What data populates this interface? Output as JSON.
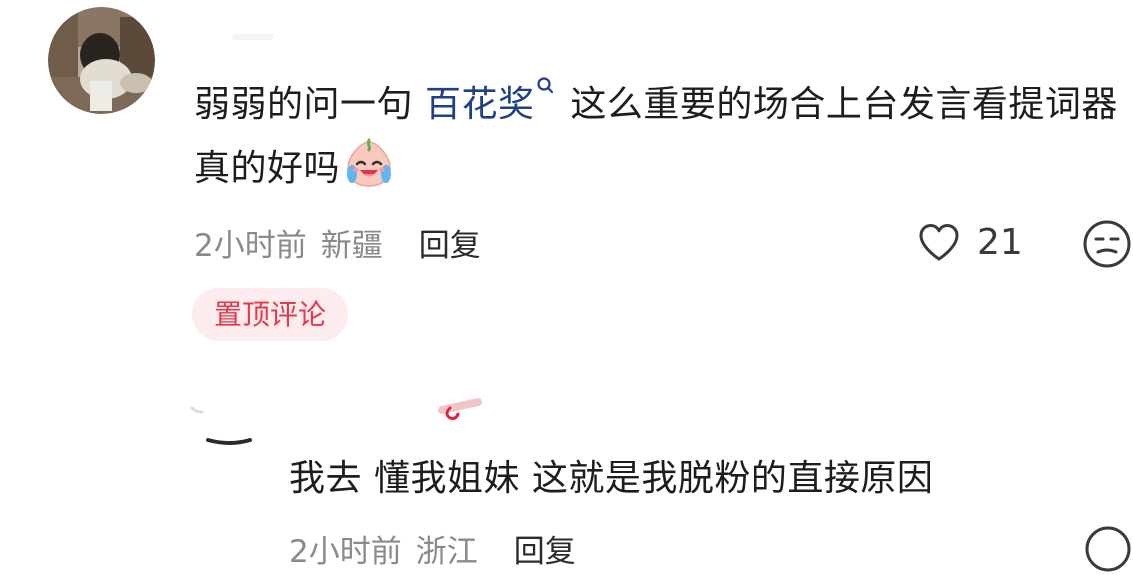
{
  "comments": [
    {
      "text_before": "弱弱的问一句  ",
      "topic": "百花奖",
      "text_after": " 这么重要的场合上台发言看提词器真的好吗",
      "time": "2小时前",
      "location": "新疆",
      "reply_label": "回复",
      "like_count": "21",
      "badge": "置顶评论"
    },
    {
      "text": "我去 懂我姐妹 这就是我脱粉的直接原因",
      "time": "2小时前",
      "location": "浙江",
      "reply_label": "回复"
    }
  ],
  "icons": {
    "heart": "heart-outline-icon",
    "dislike": "unhappy-face-icon",
    "emoji": "crying-laugh-peach-emoji",
    "topic_search": "magnifier-icon"
  },
  "colors": {
    "topic_link": "#1f3f86",
    "badge_text": "#e6384a",
    "badge_bg": "#fdecee",
    "meta_text": "#8a8a8a"
  }
}
